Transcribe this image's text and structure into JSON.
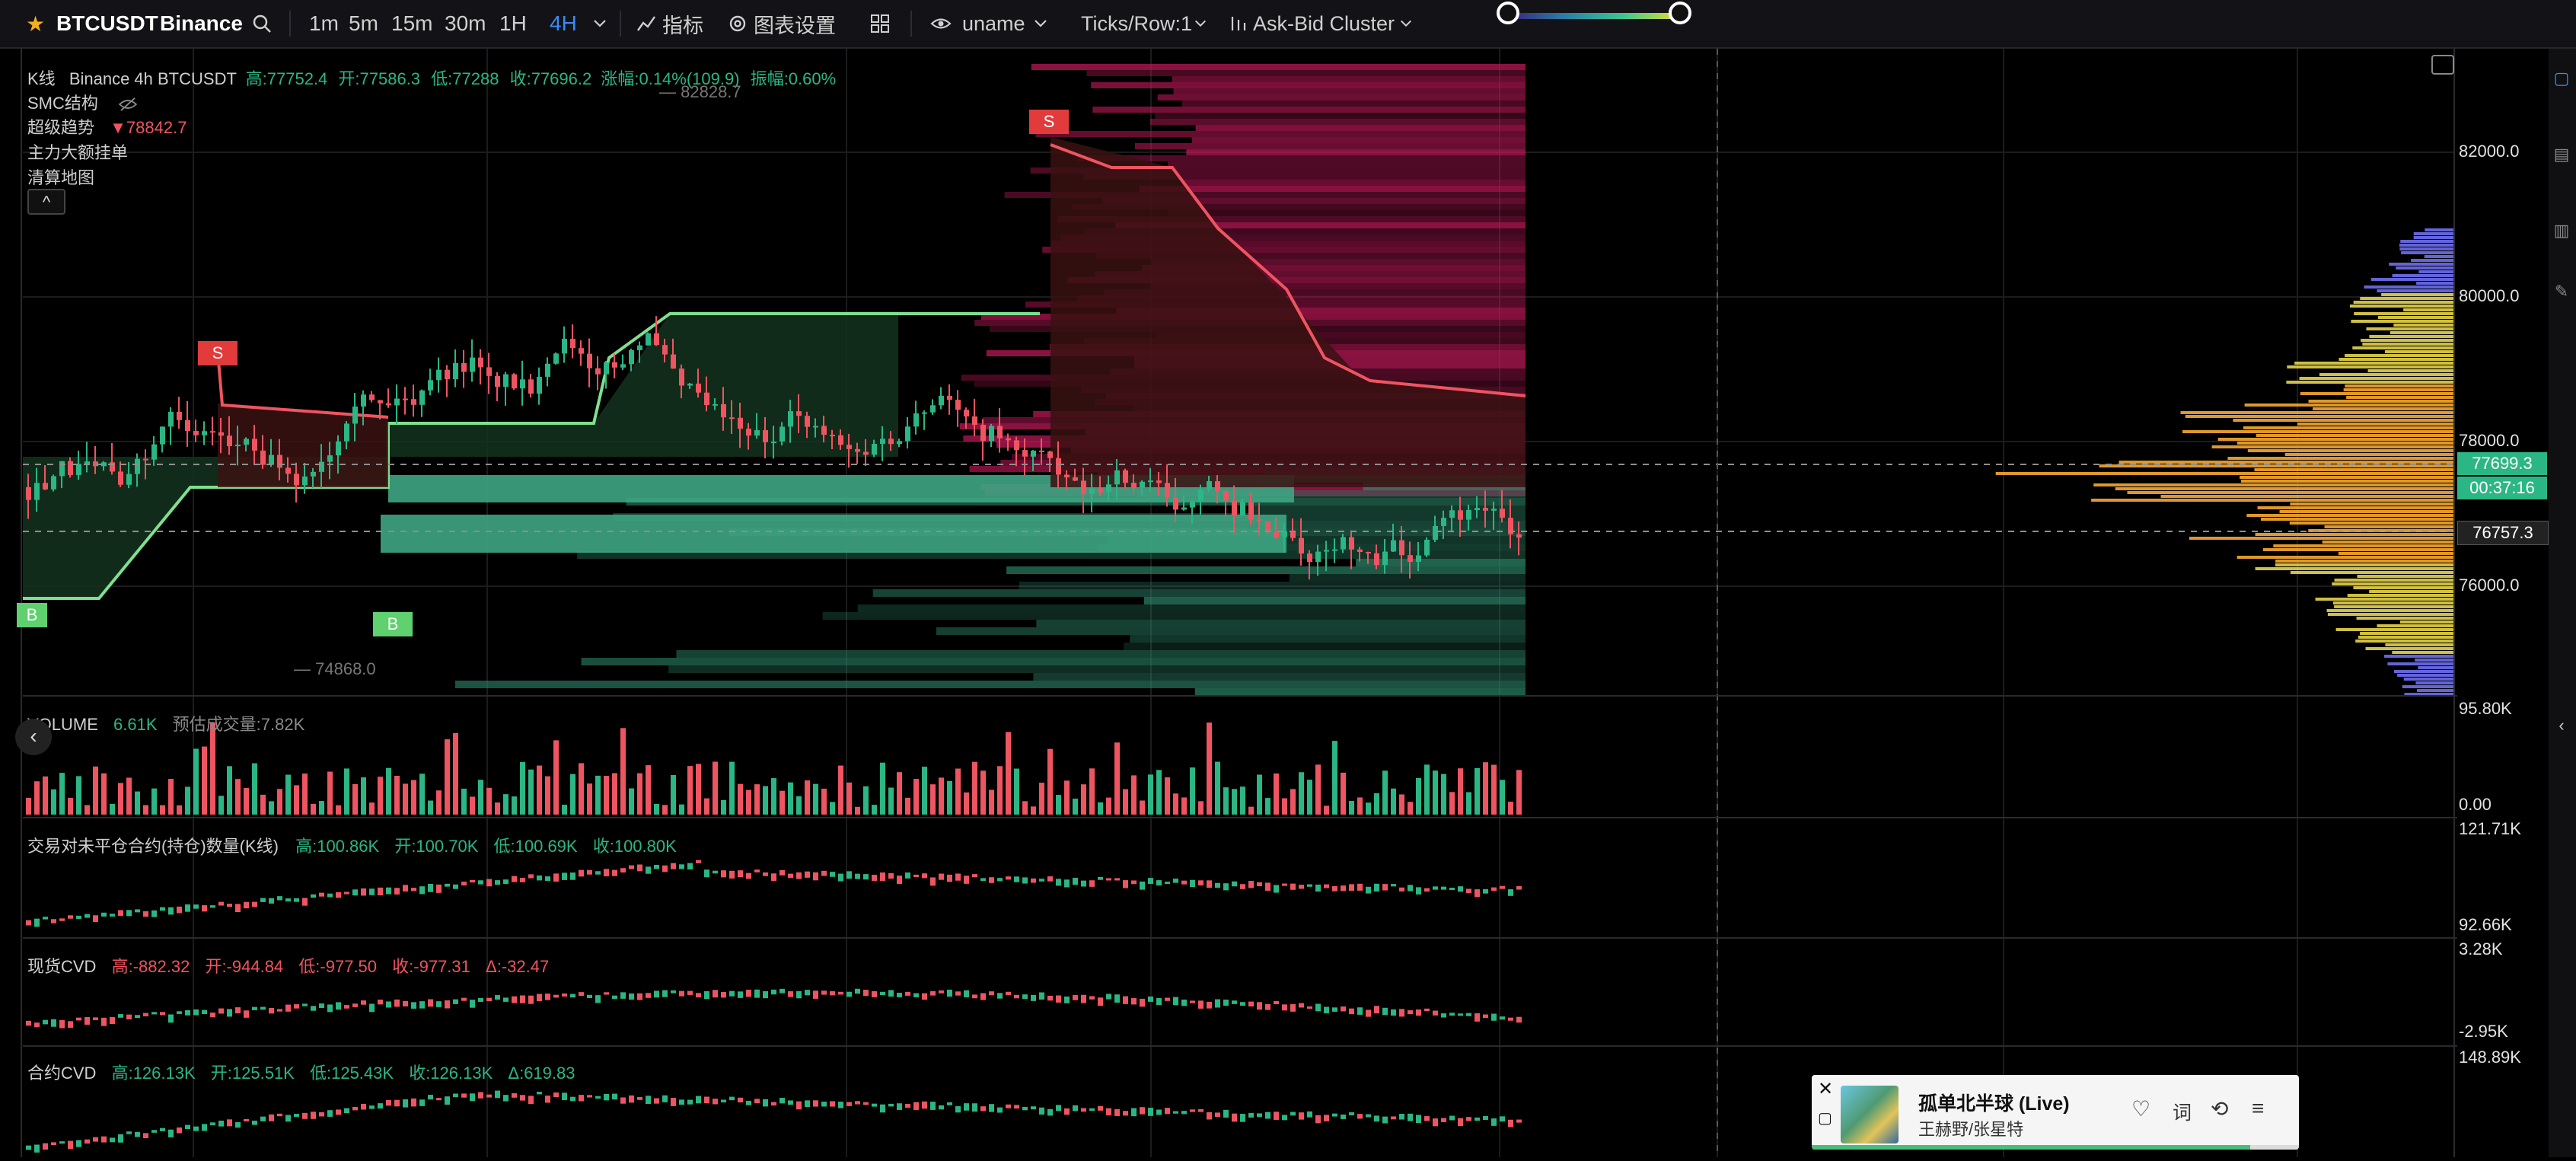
{
  "toolbar": {
    "symbol": "BTCUSDT",
    "exchange": "Binance",
    "timeframes": [
      "1m",
      "5m",
      "15m",
      "30m",
      "1H",
      "4H"
    ],
    "active_timeframe": "4H",
    "indicators_label": "指标",
    "chart_settings_label": "图表设置",
    "user_label": "uname",
    "ticks_label": "Ticks/Row:1",
    "cluster_label": "Ask-Bid Cluster"
  },
  "legend": {
    "main_prefix": "K线",
    "main_source": "Binance 4h BTCUSDT",
    "high": "高:77752.4",
    "open": "开:77586.3",
    "low": "低:77288",
    "close": "收:77696.2",
    "change": "涨幅:0.14%(109.9)",
    "amplitude": "振幅:0.60%",
    "smc": "SMC结构",
    "supertrend_label": "超级趋势",
    "supertrend_value": "▼78842.7",
    "big_orders": "主力大额挂单",
    "liquidation_map": "清算地图",
    "collapse_icon": "^"
  },
  "price_axis": {
    "labels": [
      "82000.0",
      "80000.0",
      "78000.0",
      "76000.0"
    ],
    "current_price": "77699.3",
    "countdown": "00:37:16",
    "crosshair_price": "76757.3",
    "high_marker": "82828.7",
    "low_marker": "74868.0"
  },
  "signals": {
    "sell": "S",
    "buy": "B"
  },
  "volume_pane": {
    "title": "VOLUME",
    "value": "6.61K",
    "estimated": "预估成交量:7.82K",
    "axis_top": "95.80K",
    "axis_bottom": "0.00"
  },
  "oi_pane": {
    "title": "交易对未平仓合约(持仓)数量(K线)",
    "high": "高:100.86K",
    "open": "开:100.70K",
    "low": "低:100.69K",
    "close": "收:100.80K",
    "axis_top": "121.71K",
    "axis_bottom": "92.66K"
  },
  "spot_cvd_pane": {
    "title": "现货CVD",
    "high": "高:-882.32",
    "open": "开:-944.84",
    "low": "低:-977.50",
    "close": "收:-977.31",
    "delta": "Δ:-32.47",
    "axis_top": "3.28K",
    "axis_bottom": "-2.95K"
  },
  "futures_cvd_pane": {
    "title": "合约CVD",
    "high": "高:126.13K",
    "open": "开:125.51K",
    "low": "低:125.43K",
    "close": "收:126.13K",
    "delta": "Δ:619.83",
    "axis_top": "148.89K"
  },
  "player": {
    "song": "孤单北半球 (Live)",
    "artist": "王赫野/张星特",
    "lyrics_label": "词",
    "progress": 0.9
  },
  "colors": {
    "up": "#2bb685",
    "down": "#ef5461",
    "accent": "#3d8af7"
  },
  "chart_data": {
    "type": "candlestick",
    "title": "",
    "ylim": [
      74500,
      83200
    ],
    "x": [],
    "series": []
  }
}
